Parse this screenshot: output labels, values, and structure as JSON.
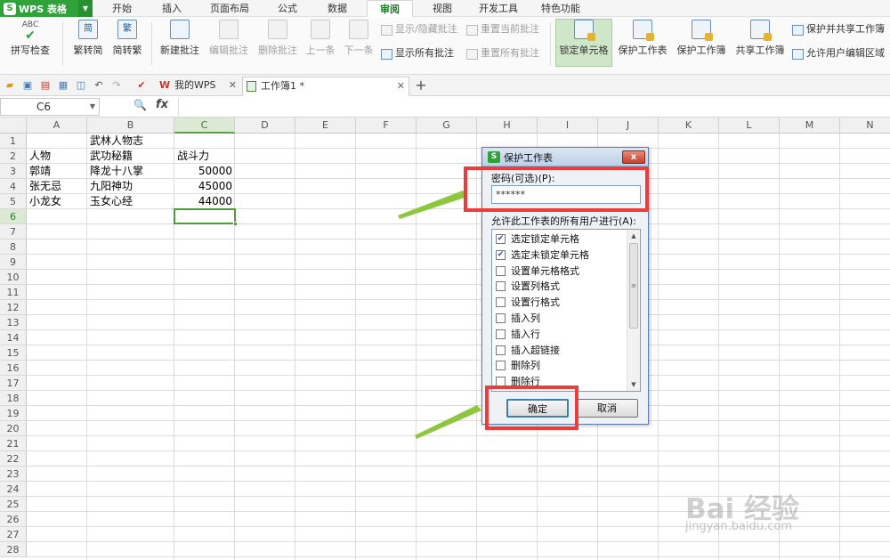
{
  "app": {
    "name": "WPS 表格",
    "logo_letter": "S"
  },
  "menu": {
    "tabs": [
      "开始",
      "插入",
      "页面布局",
      "公式",
      "数据",
      "审阅",
      "视图",
      "开发工具",
      "特色功能"
    ],
    "active": "审阅"
  },
  "ribbon": {
    "spell": "拼写检查",
    "t2s": "繁转简",
    "s2t": "简转繁",
    "t2s_icon": "简",
    "s2t_icon": "繁",
    "new_comment": "新建批注",
    "edit_comment": "编辑批注",
    "del_comment": "删除批注",
    "prev": "上一条",
    "next": "下一条",
    "show_hide": "显示/隐藏批注",
    "show_all": "显示所有批注",
    "reset_cur": "重置当前批注",
    "reset_all": "重置所有批注",
    "lock_cell": "锁定单元格",
    "protect_sheet": "保护工作表",
    "protect_book": "保护工作簿",
    "share_book": "共享工作簿",
    "protect_share": "保护并共享工作簿",
    "allow_edit": "允许用户编辑区域",
    "abc": "ABC"
  },
  "tabs": [
    {
      "label": "我的WPS"
    },
    {
      "label": "工作簿1 *"
    }
  ],
  "namebox": "C6",
  "fx": "fx",
  "columns": [
    "A",
    "B",
    "C",
    "D",
    "E",
    "F",
    "G",
    "H",
    "I",
    "J",
    "K",
    "L",
    "M",
    "N"
  ],
  "rows": [
    "1",
    "2",
    "3",
    "4",
    "5",
    "6",
    "7",
    "8",
    "9",
    "10",
    "11",
    "12",
    "13",
    "14",
    "15",
    "16",
    "17",
    "18",
    "19",
    "20",
    "21",
    "22",
    "23",
    "24",
    "25",
    "26",
    "27",
    "28"
  ],
  "cells": {
    "b1": "武林人物志",
    "a2": "人物",
    "b2": "武功秘籍",
    "c2": "战斗力",
    "a3": "郭靖",
    "b3": "降龙十八掌",
    "c3": "50000",
    "a4": "张无忌",
    "b4": "九阳神功",
    "c4": "45000",
    "a5": "小龙女",
    "b5": "玉女心经",
    "c5": "44000"
  },
  "dialog": {
    "title": "保护工作表",
    "close": "x",
    "pw_label": "密码(可选)(P):",
    "pw_value": "******",
    "perm_label": "允许此工作表的所有用户进行(A):",
    "perms": [
      {
        "label": "选定锁定单元格",
        "checked": true
      },
      {
        "label": "选定未锁定单元格",
        "checked": true
      },
      {
        "label": "设置单元格格式",
        "checked": false
      },
      {
        "label": "设置列格式",
        "checked": false
      },
      {
        "label": "设置行格式",
        "checked": false
      },
      {
        "label": "插入列",
        "checked": false
      },
      {
        "label": "插入行",
        "checked": false
      },
      {
        "label": "插入超链接",
        "checked": false
      },
      {
        "label": "删除列",
        "checked": false
      },
      {
        "label": "删除行",
        "checked": false
      }
    ],
    "ok": "确定",
    "cancel": "取消"
  },
  "watermark": {
    "text": "Bai 经验",
    "url": "jingyan.baidu.com"
  },
  "colors": {
    "accent": "#2fa33a",
    "highlight": "#ee3b3b",
    "arrow": "#8dc63f"
  }
}
